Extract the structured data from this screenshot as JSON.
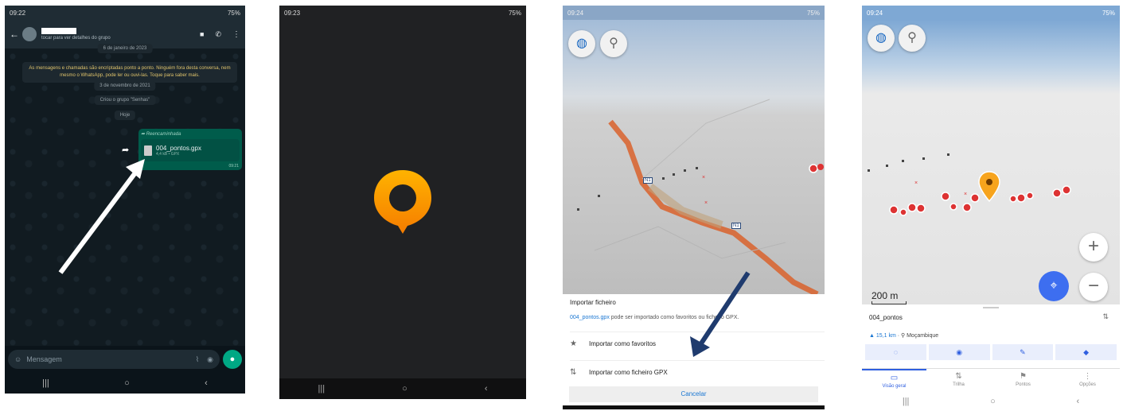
{
  "phone1": {
    "status_time": "09:22",
    "status_right": "75%",
    "header_subtitle": "tocar para ver detalhes do grupo",
    "date_pill": "6 de janeiro de 2023",
    "encryption_note": "As mensagens e chamadas são encriptadas ponto a ponto. Ninguém fora desta conversa, nem mesmo o WhatsApp, pode ler ou ouvi-las. Toque para saber mais.",
    "date_pill2": "3 de novembro de 2021",
    "group_created": "Criou o grupo \"Senhas\"",
    "today": "Hoje",
    "forwarded_label": "Reencaminhada",
    "file_name": "004_pontos.gpx",
    "file_meta": "4,4 kB • GPX",
    "msg_time": "09:21",
    "composer_placeholder": "Mensagem"
  },
  "phone2": {
    "status_time": "09:23",
    "status_right": "75%",
    "logo_color": "#ff9800"
  },
  "phone3": {
    "status_time": "09:24",
    "status_right": "75%",
    "road_label_1": "N1",
    "road_label_2": "N1",
    "dialog_title": "Importar ficheiro",
    "file_link": "004_pontos.gpx",
    "dialog_desc": " pode ser importado como favoritos ou ficheiro GPX.",
    "option_favorites": "Importar como favoritos",
    "option_gpx": "Importar como ficheiro GPX",
    "cancel_label": "Cancelar"
  },
  "phone4": {
    "status_time": "09:24",
    "status_right": "75%",
    "scale_label": "200 m",
    "track_name": "004_pontos",
    "distance": "15,1 km",
    "place": "Moçambique",
    "tabs": [
      "Visão geral",
      "Trilha",
      "Pontos",
      "Opções"
    ]
  }
}
